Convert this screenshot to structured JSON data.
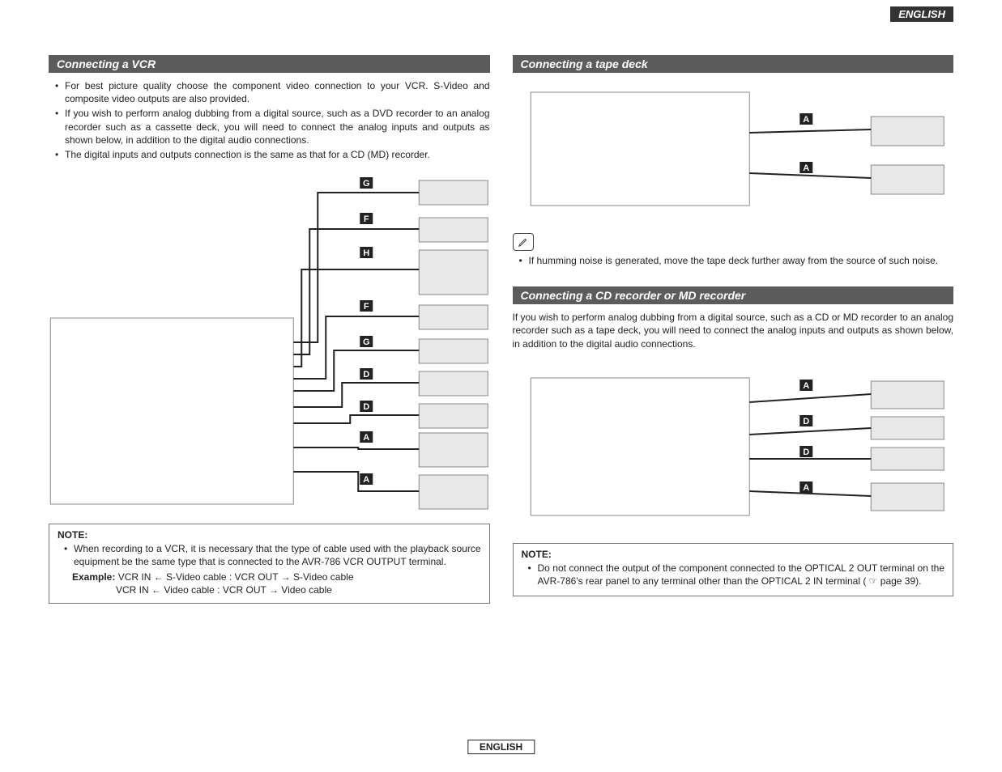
{
  "header": {
    "lang_tab": "ENGLISH"
  },
  "footer": {
    "lang": "ENGLISH"
  },
  "left": {
    "h_vcr": "Connecting a VCR",
    "vcr_bullets": [
      "For best picture quality choose the component video connection to your VCR. S-Video and composite video outputs are also provided.",
      "If you wish to perform analog dubbing from a digital source, such as a DVD recorder to an analog recorder such as a cassette deck, you will need to connect the analog inputs and outputs as shown below, in addition to the digital audio connections.",
      "The digital inputs and outputs connection is the same as that for a CD (MD) recorder."
    ],
    "note": {
      "title": "NOTE:",
      "bullet": "When recording to a VCR, it is necessary that the type of cable used with the playback source equipment be the same type that is connected to the AVR-786 VCR OUTPUT terminal.",
      "example_label": "Example:",
      "example_line1_a": "VCR IN ← S-Video cable : VCR OUT → S-Video cable",
      "example_line2_a": "VCR IN ← Video cable : VCR OUT → Video cable"
    },
    "vcr_cables": [
      "G",
      "F",
      "H",
      "F",
      "G",
      "D",
      "D",
      "A",
      "A"
    ]
  },
  "right": {
    "h_tape": "Connecting a tape deck",
    "tape_cables": [
      "A",
      "A"
    ],
    "tape_note": "If humming noise is generated, move the tape deck further away from the source of such noise.",
    "h_cd": "Connecting a CD recorder or MD recorder",
    "cd_intro": "If you wish to perform analog dubbing from a digital source, such as a CD or MD recorder to an analog recorder such as a tape deck, you will need to connect the analog inputs and outputs as shown below, in addition to the digital audio connections.",
    "cd_cables": [
      "A",
      "D",
      "D",
      "A"
    ],
    "cd_note": {
      "title": "NOTE:",
      "bullet_a": "Do not connect the output of the component connected to the OPTICAL 2 OUT terminal on the AVR-786's rear panel to any terminal other than the OPTICAL 2 IN terminal (",
      "page_ref": "page 39).",
      "hand_icon_alt": "☞"
    }
  }
}
